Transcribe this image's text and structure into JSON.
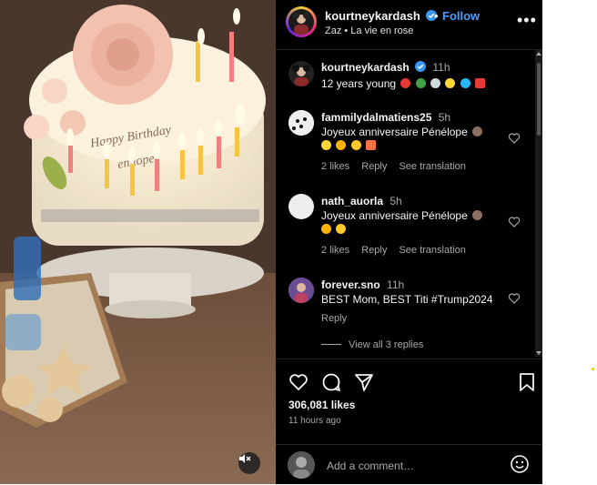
{
  "post": {
    "username": "kourtneykardash",
    "follow_label": "Follow",
    "follow_separator": "•",
    "audio": "Zaz • La vie en rose",
    "more_label": "•••",
    "caption_time": "11h",
    "caption_text": "12 years young",
    "caption_emojis": [
      "balloon",
      "palm-tree",
      "sparkle",
      "sun",
      "wave",
      "heart"
    ],
    "likes": "306,081 likes",
    "posted_ago": "11 hours ago",
    "add_comment_placeholder": "Add a comment…"
  },
  "photo": {
    "cake_text_line1": "Happy Birthday",
    "cake_text_line2": "en lope!"
  },
  "comments": [
    {
      "username": "fammilydalmatiens25",
      "time": "5h",
      "text": "Joyeux anniversaire Pénélope",
      "likes": "2 likes",
      "reply": "Reply",
      "translate": "See translation"
    },
    {
      "username": "nath_auorla",
      "time": "5h",
      "text": "Joyeux anniversaire Pénélope",
      "likes": "2 likes",
      "reply": "Reply",
      "translate": "See translation"
    },
    {
      "username": "forever.sno",
      "time": "11h",
      "text": "BEST Mom, BEST Titi #Trump2024",
      "reply": "Reply",
      "view_replies": "View all 3 replies"
    }
  ],
  "colors": {
    "panel_bg": "#000000",
    "link_blue": "#4a9eff",
    "muted_text": "#a8a8a8",
    "verified_blue": "#3897f0"
  }
}
